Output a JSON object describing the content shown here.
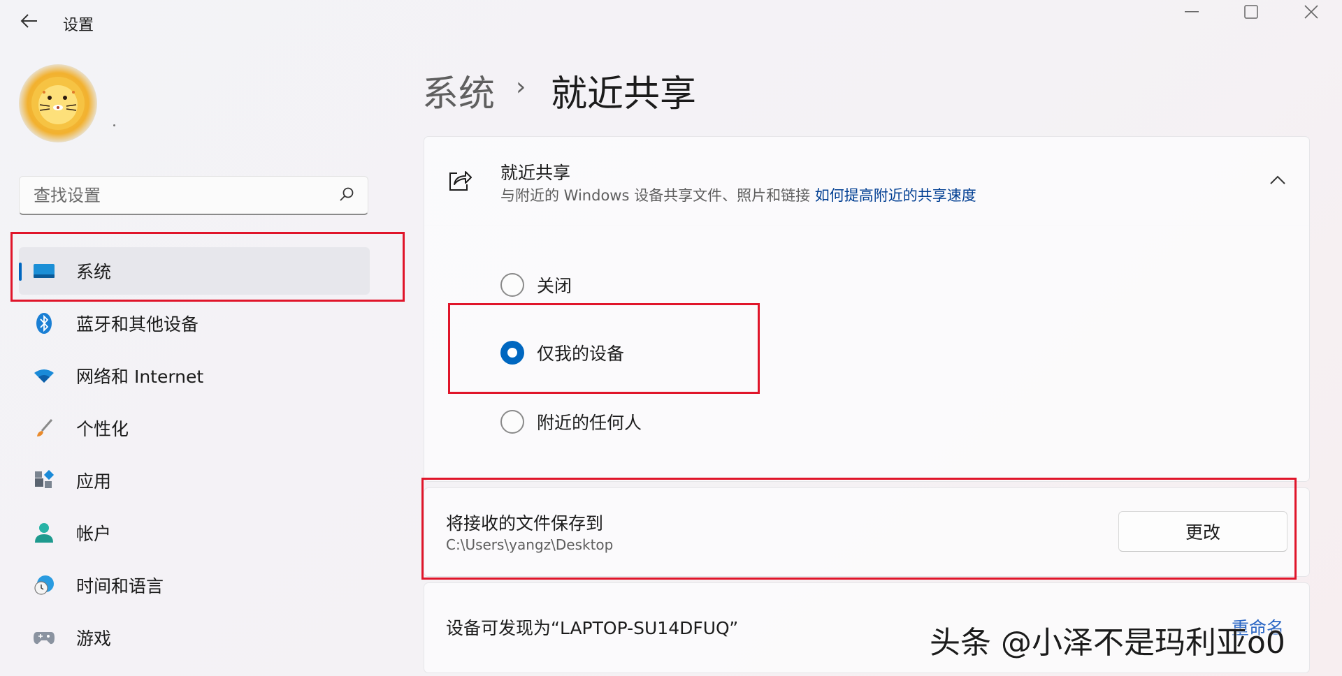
{
  "app": {
    "title": "设置"
  },
  "search": {
    "placeholder": "查找设置"
  },
  "nav": [
    {
      "label": "系统",
      "icon": "system-display-icon"
    },
    {
      "label": "蓝牙和其他设备",
      "icon": "bluetooth-icon"
    },
    {
      "label": "网络和 Internet",
      "icon": "wifi-icon"
    },
    {
      "label": "个性化",
      "icon": "brush-icon"
    },
    {
      "label": "应用",
      "icon": "apps-icon"
    },
    {
      "label": "帐户",
      "icon": "person-icon"
    },
    {
      "label": "时间和语言",
      "icon": "clock-globe-icon"
    },
    {
      "label": "游戏",
      "icon": "gamepad-icon"
    }
  ],
  "breadcrumb": {
    "parent": "系统",
    "separator": "›",
    "current": "就近共享"
  },
  "nearby_sharing": {
    "title": "就近共享",
    "subtitle": "与附近的 Windows 设备共享文件、照片和链接",
    "link": "如何提高附近的共享速度",
    "options": [
      {
        "label": "关闭",
        "selected": false
      },
      {
        "label": "仅我的设备",
        "selected": true
      },
      {
        "label": "附近的任何人",
        "selected": false
      }
    ]
  },
  "save_location": {
    "title": "将接收的文件保存到",
    "path": "C:\\Users\\yangz\\Desktop",
    "button": "更改"
  },
  "discoverable": {
    "text": "设备可发现为“LAPTOP-SU14DFUQ”",
    "rename_link": "重命名"
  },
  "watermark": "头条 @小泽不是玛利亚o0",
  "colors": {
    "accent": "#0067c0",
    "annotation": "#e0152a",
    "link": "#003e92"
  }
}
